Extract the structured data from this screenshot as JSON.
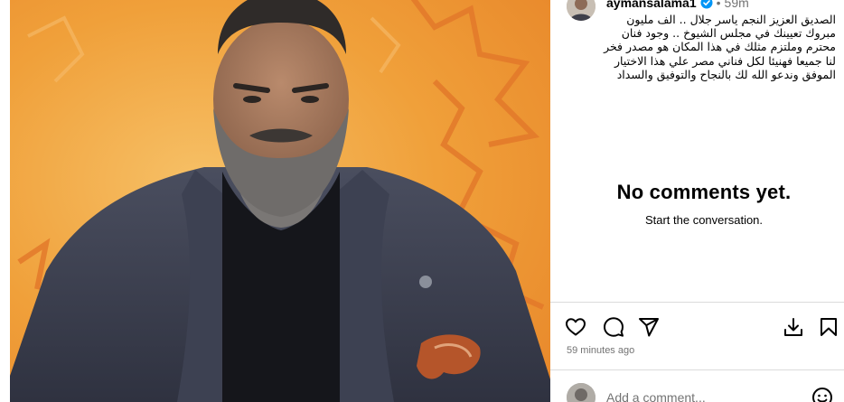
{
  "post": {
    "username": "aymansalama1",
    "time_ago": "59m",
    "caption": "الصديق العزيز النجم ياسر جلال .. الف مليون مبروك تعيينك في مجلس الشيوخ .. وجود فنان محترم وملتزم مثلك في هذا المكان هو مصدر فخر لنا جميعا فهنيئا لكل فناني مصر علي هذا الاختيار الموفق وندعو الله لك بالنجاح والتوفيق والسداد"
  },
  "comments": {
    "empty_title": "No comments yet.",
    "empty_subtitle": "Start the conversation."
  },
  "actions": {
    "timestamp": "59 minutes ago",
    "icons": [
      "heart-icon",
      "comment-icon",
      "share-icon",
      "download-icon",
      "bookmark-icon"
    ]
  },
  "comment_box": {
    "placeholder": "Add a comment...",
    "icons": [
      "emoji-icon"
    ]
  },
  "colors": {
    "photo_background": "#f0a03a",
    "verified": "#0095f6",
    "muted_text": "#737373",
    "divider": "#dbdbdb"
  }
}
